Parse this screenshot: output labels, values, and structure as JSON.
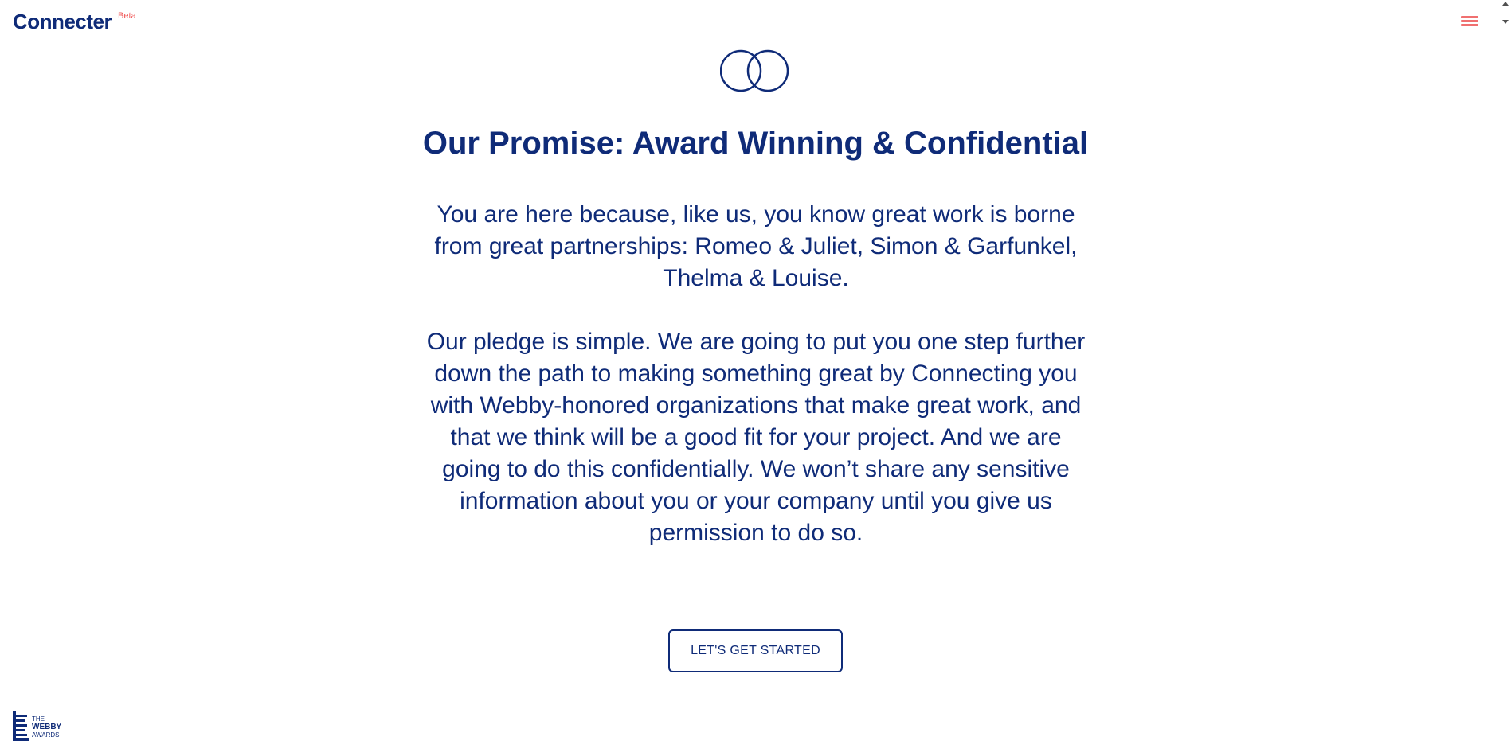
{
  "header": {
    "logo": "Connecter",
    "badge": "Beta",
    "menu_icon": "hamburger-menu-icon"
  },
  "hero": {
    "icon": "interlocking-rings-icon",
    "title": "Our Promise: Award Winning & Confidential",
    "paragraph_1": "You are here because, like us, you know great work is borne from great partnerships: Romeo & Juliet, Simon & Garfunkel, Thelma & Louise.",
    "paragraph_2": "Our pledge is simple. We are going to put you one step further down the path to making something great by Connecting you with Webby-honored organizations that make great work, and that we think will be a good fit for your project. And we are going to do this confidentially. We won’t share any sensitive information about you or your company until you give us permission to do so."
  },
  "cta": {
    "label": "LET'S GET STARTED"
  },
  "footer": {
    "webby_the": "THE",
    "webby_name": "WEBBY",
    "webby_awards": "AWARDS"
  },
  "colors": {
    "primary": "#0f2b78",
    "accent": "#f05a5a",
    "background": "#ffffff"
  }
}
